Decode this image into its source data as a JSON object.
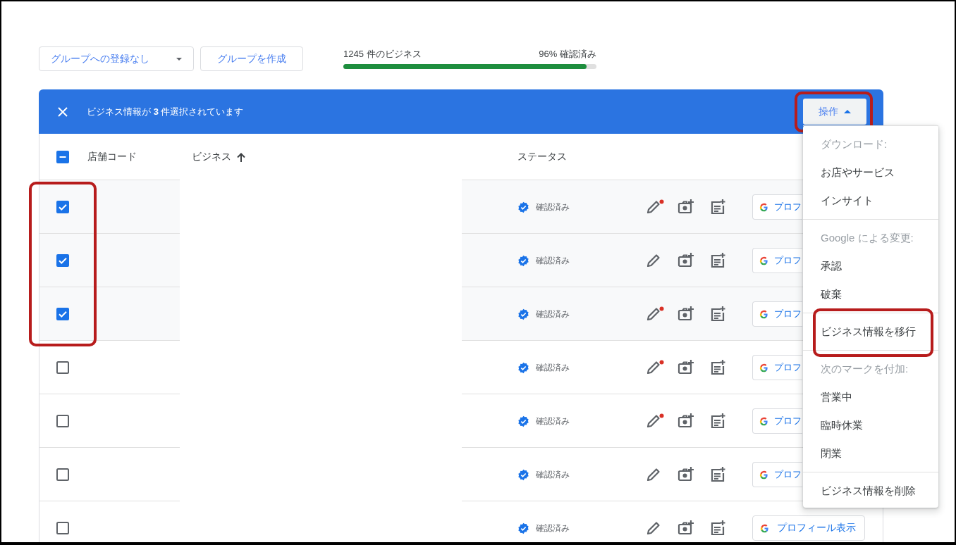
{
  "toolbar": {
    "group_dropdown": {
      "label": "グループへの登録なし"
    },
    "create_group_button": {
      "label": "グループを作成"
    },
    "summary": {
      "count": "1245 件のビジネス",
      "verified": "96% 確認済み",
      "level": 0.96
    }
  },
  "selection_bar": {
    "text": "ビジネス情報が **3** 件選択されています",
    "action_button": {
      "label": "操作",
      "highlighted": true
    }
  },
  "table": {
    "columns": [
      "店舗コード",
      "ビジネス",
      "ステータス"
    ],
    "select_all": {
      "indeterminate": true
    },
    "selection_highlighted": true,
    "rows": [
      {
        "selected": true,
        "status": "確認済み",
        "edit_notice": true,
        "profile_button": "プロフ"
      },
      {
        "selected": true,
        "status": "確認済み",
        "edit_notice": false,
        "profile_button": "プロフ"
      },
      {
        "selected": true,
        "status": "確認済み",
        "edit_notice": true,
        "profile_button": "プロフ"
      },
      {
        "selected": false,
        "status": "確認済み",
        "edit_notice": true,
        "profile_button": "プロフ"
      },
      {
        "selected": false,
        "status": "確認済み",
        "edit_notice": true,
        "profile_button": "プロフ"
      },
      {
        "selected": false,
        "status": "確認済み",
        "edit_notice": false,
        "profile_button": "プロフ"
      },
      {
        "selected": false,
        "status": "確認済み",
        "edit_notice": false,
        "profile_button": "プロフィール表示"
      }
    ]
  },
  "action_menu": {
    "sections": [
      {
        "header": "ダウンロード:",
        "items": [
          {
            "label": "お店やサービス",
            "highlighted": false
          },
          {
            "label": "インサイト",
            "highlighted": false
          }
        ]
      },
      {
        "header": "Google による変更:",
        "items": [
          {
            "label": "承認",
            "highlighted": false
          },
          {
            "label": "破棄",
            "highlighted": false
          }
        ]
      },
      {
        "items": [
          {
            "label": "ビジネス情報を移行",
            "highlighted": true
          }
        ]
      },
      {
        "header": "次のマークを付加:",
        "items": [
          {
            "label": "営業中",
            "highlighted": false
          },
          {
            "label": "臨時休業",
            "highlighted": false
          },
          {
            "label": "閉業",
            "highlighted": false
          }
        ]
      },
      {
        "items": [
          {
            "label": "ビジネス情報を削除",
            "highlighted": false
          }
        ]
      }
    ]
  }
}
